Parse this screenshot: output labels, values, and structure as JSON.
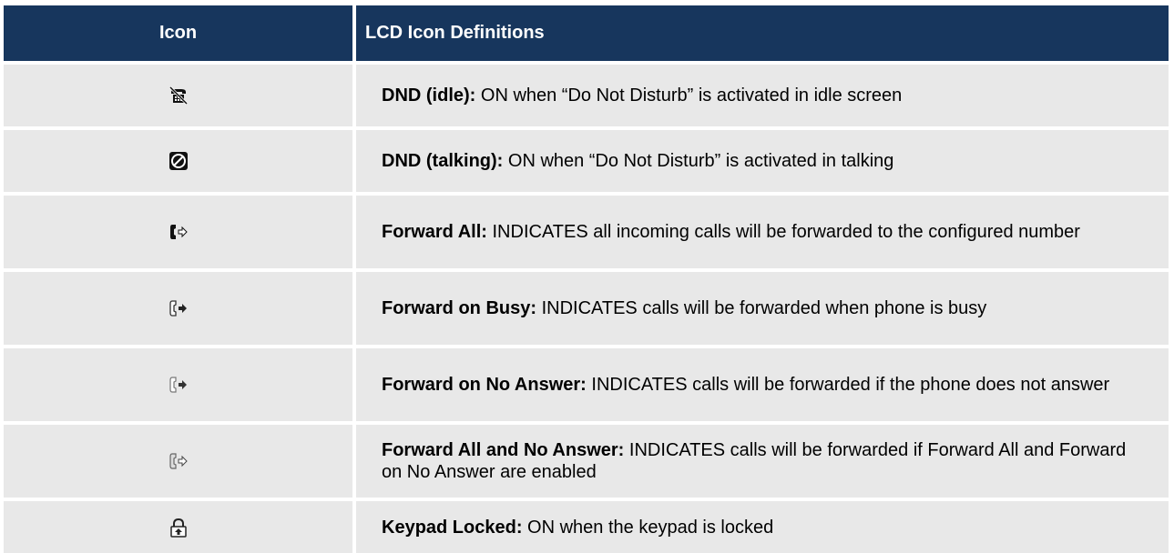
{
  "header": {
    "icon_col": "Icon",
    "def_col": "LCD Icon Definitions"
  },
  "rows": [
    {
      "icon": "dnd-idle-icon",
      "label": "DND (idle):",
      "text": " ON when “Do Not Disturb” is activated in idle screen"
    },
    {
      "icon": "dnd-talking-icon",
      "label": "DND (talking):",
      "text": " ON when “Do Not Disturb” is activated in talking"
    },
    {
      "icon": "forward-all-icon",
      "label": "Forward All:",
      "text": " INDICATES all incoming calls will be forwarded to the configured number"
    },
    {
      "icon": "forward-on-busy-icon",
      "label": "Forward on Busy:",
      "text": " INDICATES calls will be forwarded when phone is busy"
    },
    {
      "icon": "forward-on-no-answer-icon",
      "label": "Forward on No Answer:",
      "text": " INDICATES calls will be forwarded if the phone does not answer"
    },
    {
      "icon": "forward-all-and-no-answer-icon",
      "label": "Forward All and No Answer:",
      "text": " INDICATES calls will be forwarded if Forward All and Forward on No Answer are enabled"
    },
    {
      "icon": "keypad-locked-icon",
      "label": "Keypad Locked:",
      "text": " ON when the keypad is locked"
    }
  ]
}
